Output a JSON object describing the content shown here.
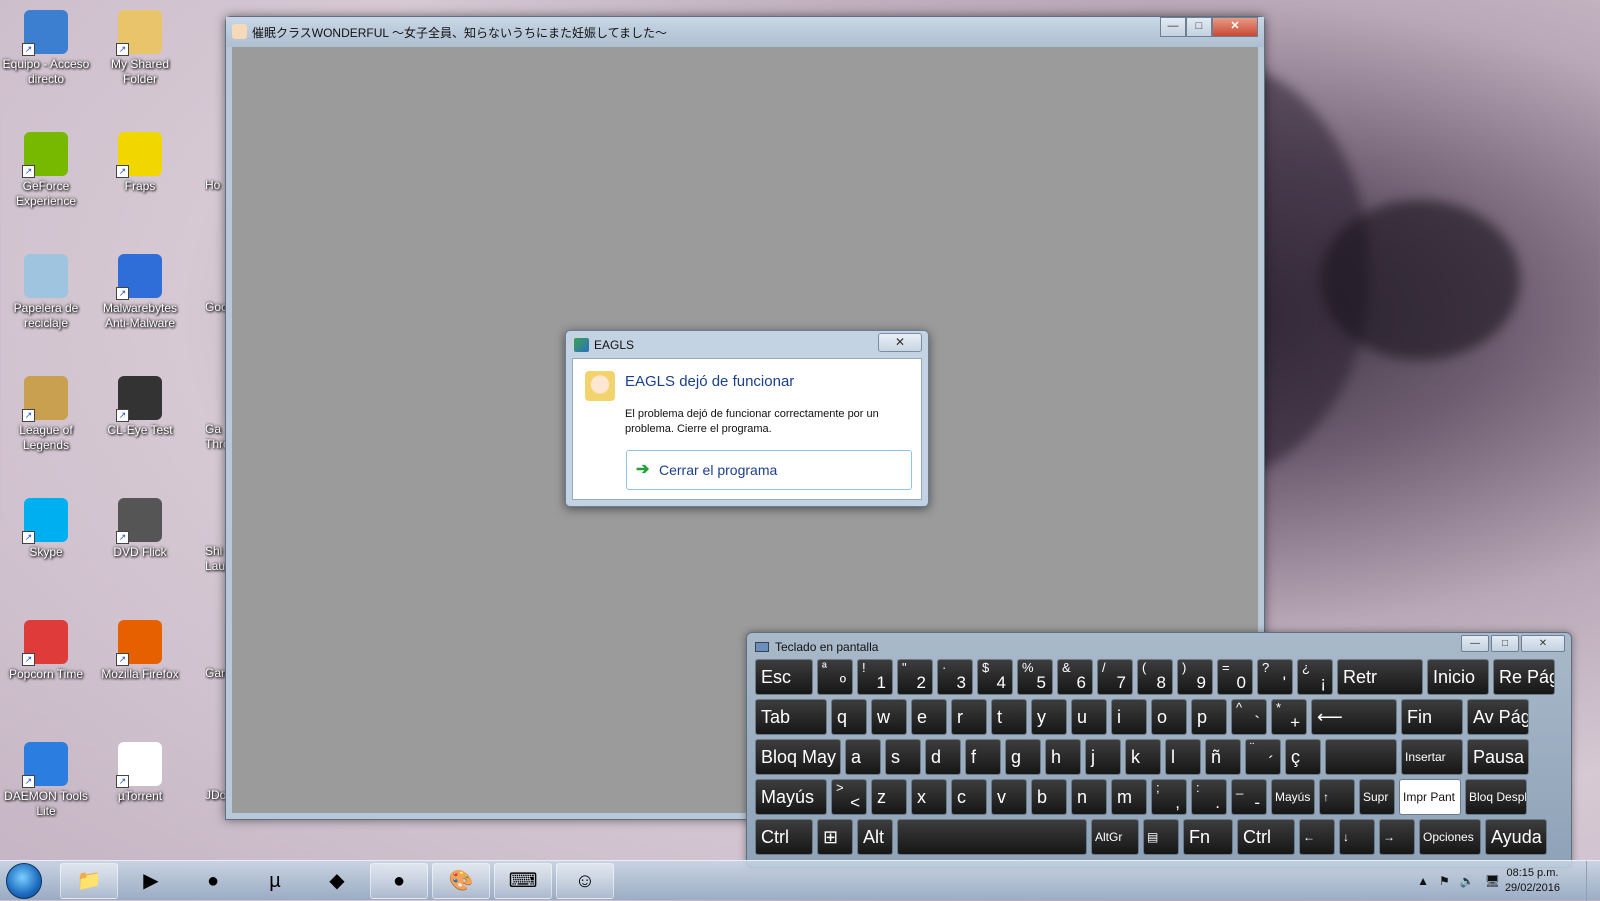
{
  "desktop": {
    "icons": [
      {
        "label": "Equipo - Acceso directo",
        "icon": "computer-icon",
        "color": "#3c7fd1"
      },
      {
        "label": "My Shared Folder",
        "icon": "folder-icon",
        "color": "#e9c46a"
      },
      {
        "label": "GeForce Experience",
        "icon": "geforce-icon",
        "color": "#76b900"
      },
      {
        "label": "Fraps",
        "icon": "fraps-icon",
        "color": "#f2d600"
      },
      {
        "label": "Papelera de reciclaje",
        "icon": "recycle-bin-icon",
        "color": "#9ec4e0"
      },
      {
        "label": "Malwarebytes Anti-Malware",
        "icon": "malwarebytes-icon",
        "color": "#2f6ed8"
      },
      {
        "label": "League of Legends",
        "icon": "league-icon",
        "color": "#c8a050"
      },
      {
        "label": "CL-Eye Test",
        "icon": "camera-icon",
        "color": "#333333"
      },
      {
        "label": "Skype",
        "icon": "skype-icon",
        "color": "#00aff0"
      },
      {
        "label": "DVD Flick",
        "icon": "film-icon",
        "color": "#555555"
      },
      {
        "label": "Popcorn Time",
        "icon": "popcorn-icon",
        "color": "#e03b3b"
      },
      {
        "label": "Mozilla Firefox",
        "icon": "firefox-icon",
        "color": "#e66000"
      },
      {
        "label": "DAEMON Tools Lite",
        "icon": "daemon-tools-icon",
        "color": "#2b7de0"
      },
      {
        "label": "µTorrent",
        "icon": "file-icon",
        "color": "#ffffff"
      }
    ],
    "partial_labels": [
      "Ho",
      "Googl",
      "Ga Thron",
      "Shi Laun",
      "Gam",
      "JDow"
    ]
  },
  "main_window": {
    "title": "催眠クラスWONDERFUL ～女子全員、知らないうちにまた妊娠してました～",
    "minimize": "—",
    "maximize": "□",
    "close": "✕",
    "rewind_icon": "◀◀"
  },
  "dialog": {
    "title": "EAGLS",
    "close": "✕",
    "heading": "EAGLS dejó de funcionar",
    "message": "El problema dejó de funcionar correctamente por un problema. Cierre el programa.",
    "button": "Cerrar el programa"
  },
  "keyboard": {
    "title": "Teclado en pantalla",
    "btn_min": "—",
    "btn_max": "□",
    "btn_close": "✕",
    "rows": [
      [
        {
          "l": "Esc",
          "w": 58
        },
        {
          "t": "ª",
          "b": "º",
          "w": 36
        },
        {
          "t": "!",
          "b": "1",
          "w": 36
        },
        {
          "t": "\"",
          "b": "2",
          "w": 36
        },
        {
          "t": "·",
          "b": "3",
          "w": 36
        },
        {
          "t": "$",
          "b": "4",
          "w": 36
        },
        {
          "t": "%",
          "b": "5",
          "w": 36
        },
        {
          "t": "&",
          "b": "6",
          "w": 36
        },
        {
          "t": "/",
          "b": "7",
          "w": 36
        },
        {
          "t": "(",
          "b": "8",
          "w": 36
        },
        {
          "t": ")",
          "b": "9",
          "w": 36
        },
        {
          "t": "=",
          "b": "0",
          "w": 36
        },
        {
          "t": "?",
          "b": "'",
          "w": 36
        },
        {
          "t": "¿",
          "b": "¡",
          "w": 36
        },
        {
          "l": "Retr",
          "w": 86
        },
        {
          "l": "Inicio",
          "w": 62
        },
        {
          "l": "Re Pág",
          "w": 62
        }
      ],
      [
        {
          "l": "Tab",
          "w": 72
        },
        {
          "l": "q",
          "w": 36
        },
        {
          "l": "w",
          "w": 36
        },
        {
          "l": "e",
          "w": 36
        },
        {
          "l": "r",
          "w": 36
        },
        {
          "l": "t",
          "w": 36
        },
        {
          "l": "y",
          "w": 36
        },
        {
          "l": "u",
          "w": 36
        },
        {
          "l": "i",
          "w": 36
        },
        {
          "l": "o",
          "w": 36
        },
        {
          "l": "p",
          "w": 36
        },
        {
          "t": "^",
          "b": "`",
          "w": 36
        },
        {
          "t": "*",
          "b": "+",
          "w": 36
        },
        {
          "l": "⟵",
          "w": 86
        },
        {
          "l": "Fin",
          "w": 62
        },
        {
          "l": "Av Pág",
          "w": 62
        }
      ],
      [
        {
          "l": "Bloq May",
          "w": 86
        },
        {
          "l": "a",
          "w": 36
        },
        {
          "l": "s",
          "w": 36
        },
        {
          "l": "d",
          "w": 36
        },
        {
          "l": "f",
          "w": 36
        },
        {
          "l": "g",
          "w": 36
        },
        {
          "l": "h",
          "w": 36
        },
        {
          "l": "j",
          "w": 36
        },
        {
          "l": "k",
          "w": 36
        },
        {
          "l": "l",
          "w": 36
        },
        {
          "l": "ñ",
          "w": 36
        },
        {
          "t": "¨",
          "b": "´",
          "w": 36
        },
        {
          "l": "ç",
          "w": 36
        },
        {
          "l": "",
          "w": 72
        },
        {
          "l": "Insertar",
          "w": 62,
          "s": true
        },
        {
          "l": "Pausa",
          "w": 62
        }
      ],
      [
        {
          "l": "Mayús",
          "w": 72
        },
        {
          "t": ">",
          "b": "<",
          "w": 36
        },
        {
          "l": "z",
          "w": 36
        },
        {
          "l": "x",
          "w": 36
        },
        {
          "l": "c",
          "w": 36
        },
        {
          "l": "v",
          "w": 36
        },
        {
          "l": "b",
          "w": 36
        },
        {
          "l": "n",
          "w": 36
        },
        {
          "l": "m",
          "w": 36
        },
        {
          "t": ";",
          "b": ",",
          "w": 36
        },
        {
          "t": ":",
          "b": ".",
          "w": 36
        },
        {
          "t": "_",
          "b": "-",
          "w": 36
        },
        {
          "l": "Mayús",
          "w": 44,
          "s": true
        },
        {
          "l": "↑",
          "w": 36,
          "s": true
        },
        {
          "l": "Supr",
          "w": 36,
          "s": true
        },
        {
          "l": "Impr Pant",
          "w": 62,
          "s": true,
          "white": true
        },
        {
          "l": "Bloq Despl",
          "w": 62,
          "s": true
        }
      ],
      [
        {
          "l": "Ctrl",
          "w": 58
        },
        {
          "l": "⊞",
          "w": 36
        },
        {
          "l": "Alt",
          "w": 36
        },
        {
          "l": "",
          "w": 190
        },
        {
          "l": "AltGr",
          "w": 48,
          "s": true
        },
        {
          "l": "▤",
          "w": 36,
          "s": true
        },
        {
          "l": "Fn",
          "w": 50
        },
        {
          "l": "Ctrl",
          "w": 58
        },
        {
          "l": "←",
          "w": 36,
          "s": true
        },
        {
          "l": "↓",
          "w": 36,
          "s": true
        },
        {
          "l": "→",
          "w": 36,
          "s": true
        },
        {
          "l": "Opciones",
          "w": 62,
          "s": true
        },
        {
          "l": "Ayuda",
          "w": 62
        }
      ]
    ]
  },
  "taskbar": {
    "start": "start-button",
    "apps": [
      {
        "name": "explorer",
        "icon": "📁",
        "active": true
      },
      {
        "name": "media-player",
        "icon": "▶",
        "active": false
      },
      {
        "name": "chrome",
        "icon": "●",
        "active": false
      },
      {
        "name": "utorrent",
        "icon": "µ",
        "active": false
      },
      {
        "name": "app-green",
        "icon": "◆",
        "active": false
      },
      {
        "name": "chrome-2",
        "icon": "●",
        "active": true
      },
      {
        "name": "paint",
        "icon": "🎨",
        "active": true
      },
      {
        "name": "osk",
        "icon": "⌨",
        "active": true
      },
      {
        "name": "game",
        "icon": "☺",
        "active": true
      }
    ],
    "tray_icons": [
      "▲",
      "⚑",
      "🔊",
      "🖥"
    ],
    "time": "08:15 p.m.",
    "date": "29/02/2016"
  }
}
